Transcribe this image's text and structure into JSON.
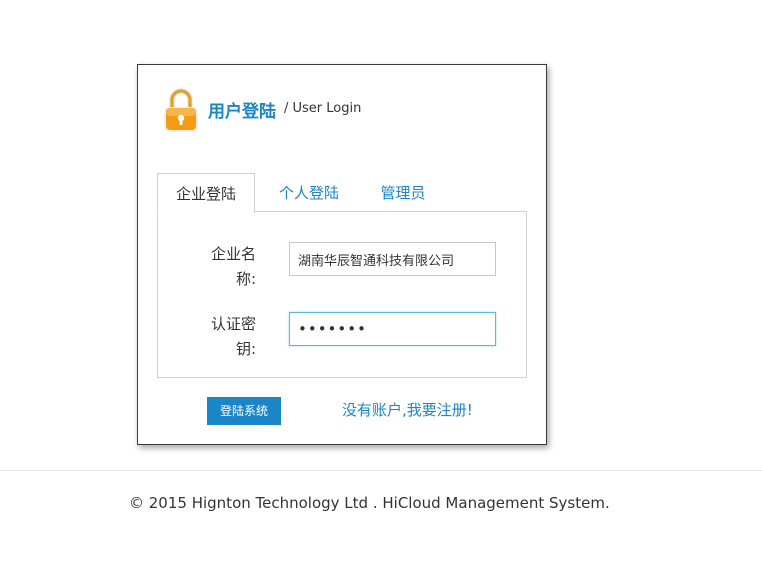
{
  "header": {
    "title": "用户登陆",
    "subtitle": "/ User Login",
    "icon": "lock-icon"
  },
  "tabs": [
    {
      "label": "企业登陆",
      "active": true
    },
    {
      "label": "个人登陆",
      "active": false
    },
    {
      "label": "管理员",
      "active": false
    }
  ],
  "form": {
    "company_label": "企业名称:",
    "company_value": "湖南华辰智通科技有限公司",
    "key_label": "认证密钥:",
    "key_value": "•••••••"
  },
  "actions": {
    "login_label": "登陆系统",
    "register_label": "没有账户,我要注册!"
  },
  "footer": {
    "copyright": "© 2015 Hignton Technology Ltd . HiCloud Management System."
  },
  "colors": {
    "accent": "#1a86c8",
    "lock_body": "#f39c12",
    "focus_border": "#5bb8e0"
  }
}
